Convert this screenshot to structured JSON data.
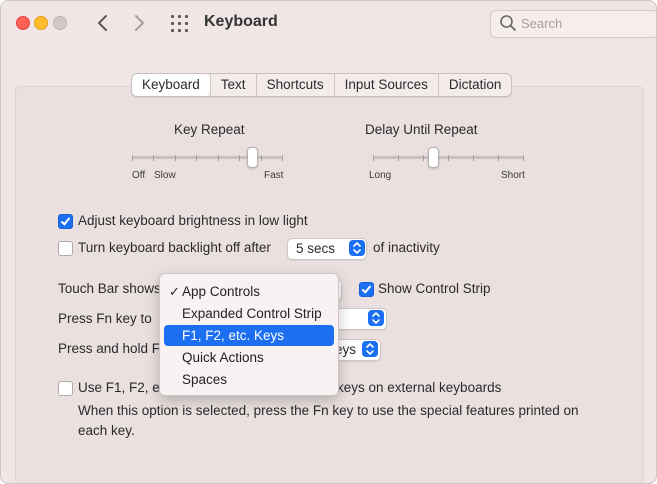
{
  "window": {
    "title": "Keyboard"
  },
  "search": {
    "placeholder": "Search"
  },
  "tabs": [
    {
      "label": "Keyboard",
      "selected": true
    },
    {
      "label": "Text",
      "selected": false
    },
    {
      "label": "Shortcuts",
      "selected": false
    },
    {
      "label": "Input Sources",
      "selected": false
    },
    {
      "label": "Dictation",
      "selected": false
    }
  ],
  "key_repeat": {
    "title": "Key Repeat",
    "label_off": "Off",
    "label_slow": "Slow",
    "label_fast": "Fast",
    "level": 0.8
  },
  "delay_repeat": {
    "title": "Delay Until Repeat",
    "label_long": "Long",
    "label_short": "Short",
    "level": 0.4
  },
  "options": {
    "adjust_brightness": {
      "label": "Adjust keyboard brightness in low light",
      "checked": true
    },
    "backlight_off": {
      "label": "Turn keyboard backlight off after",
      "checked": false,
      "value": "5 secs",
      "suffix": "of inactivity"
    }
  },
  "touch_bar": {
    "label": "Touch Bar shows",
    "show_strip_label": "Show Control Strip",
    "show_strip_checked": true
  },
  "fn_key": {
    "label": "Press Fn key to"
  },
  "press_hold": {
    "label": "Press and hold F",
    "value_partial": "eys"
  },
  "use_f_keys": {
    "label_start": "Use F1, F2, et",
    "label_end": "keys on external keyboards",
    "checked": false,
    "description": "When this option is selected, press the Fn key to use the special features printed on each key."
  },
  "dropdown_menu": {
    "items": [
      {
        "label": "App Controls",
        "checked": true,
        "highlighted": false
      },
      {
        "label": "Expanded Control Strip",
        "checked": false,
        "highlighted": false
      },
      {
        "label": "F1, F2, etc. Keys",
        "checked": false,
        "highlighted": true
      },
      {
        "label": "Quick Actions",
        "checked": false,
        "highlighted": false
      },
      {
        "label": "Spaces",
        "checked": false,
        "highlighted": false
      }
    ],
    "check_glyph": "✓"
  },
  "colors": {
    "accent": "#1b6ff0",
    "close": "#fe5f57",
    "minimize": "#febc2e"
  }
}
